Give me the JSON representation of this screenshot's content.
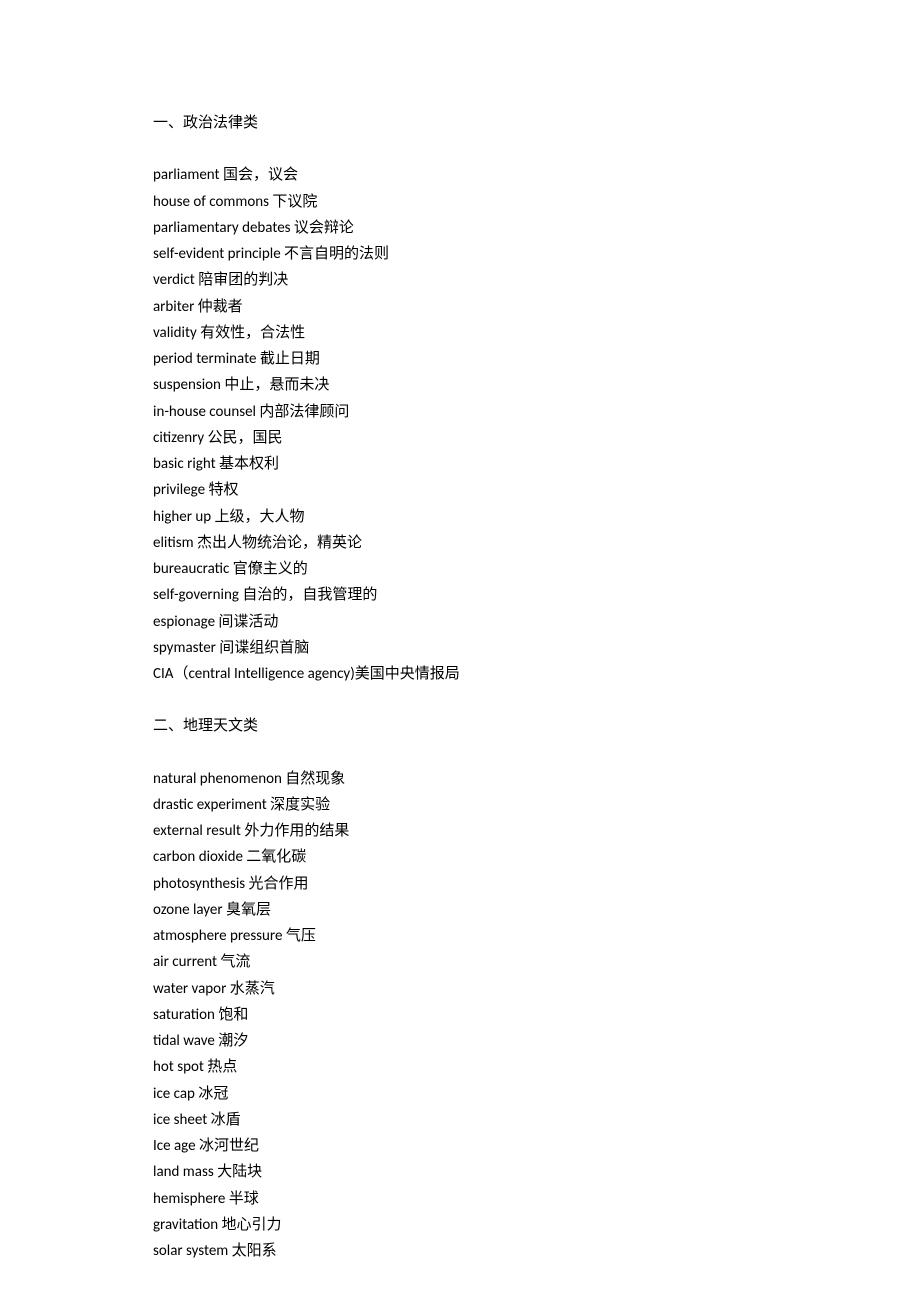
{
  "sections": [
    {
      "heading": "一、政治法律类",
      "entries": [
        "parliament  国会，议会",
        "house of commons  下议院",
        "parliamentary debates  议会辩论",
        "self-evident principle  不言自明的法则",
        "verdict  陪审团的判决",
        "arbiter  仲裁者",
        "validity  有效性，合法性",
        "period terminate  截止日期",
        "suspension  中止，悬而未决",
        "in-house counsel  内部法律顾问",
        "citizenry  公民，国民",
        "basic right  基本权利",
        "privilege  特权",
        "higher up  上级，大人物",
        "elitism  杰出人物统治论，精英论",
        "bureaucratic  官僚主义的",
        "self-governing  自治的，自我管理的",
        "espionage  间谍活动",
        "spymaster  间谍组织首脑",
        "CIA（central Intelligence agency)美国中央情报局"
      ]
    },
    {
      "heading": "二、地理天文类",
      "entries": [
        "natural phenomenon  自然现象",
        "drastic experiment  深度实验",
        "external result  外力作用的结果",
        "carbon dioxide  二氧化碳",
        "photosynthesis  光合作用",
        "ozone layer  臭氧层",
        "atmosphere pressure  气压",
        "air current  气流",
        "water vapor  水蒸汽",
        "saturation  饱和",
        "tidal wave  潮汐",
        "hot spot  热点",
        "ice cap  冰冠",
        "ice sheet  冰盾",
        "Ice age  冰河世纪",
        "land mass  大陆块",
        "hemisphere  半球",
        "gravitation  地心引力",
        "solar system  太阳系"
      ]
    }
  ]
}
